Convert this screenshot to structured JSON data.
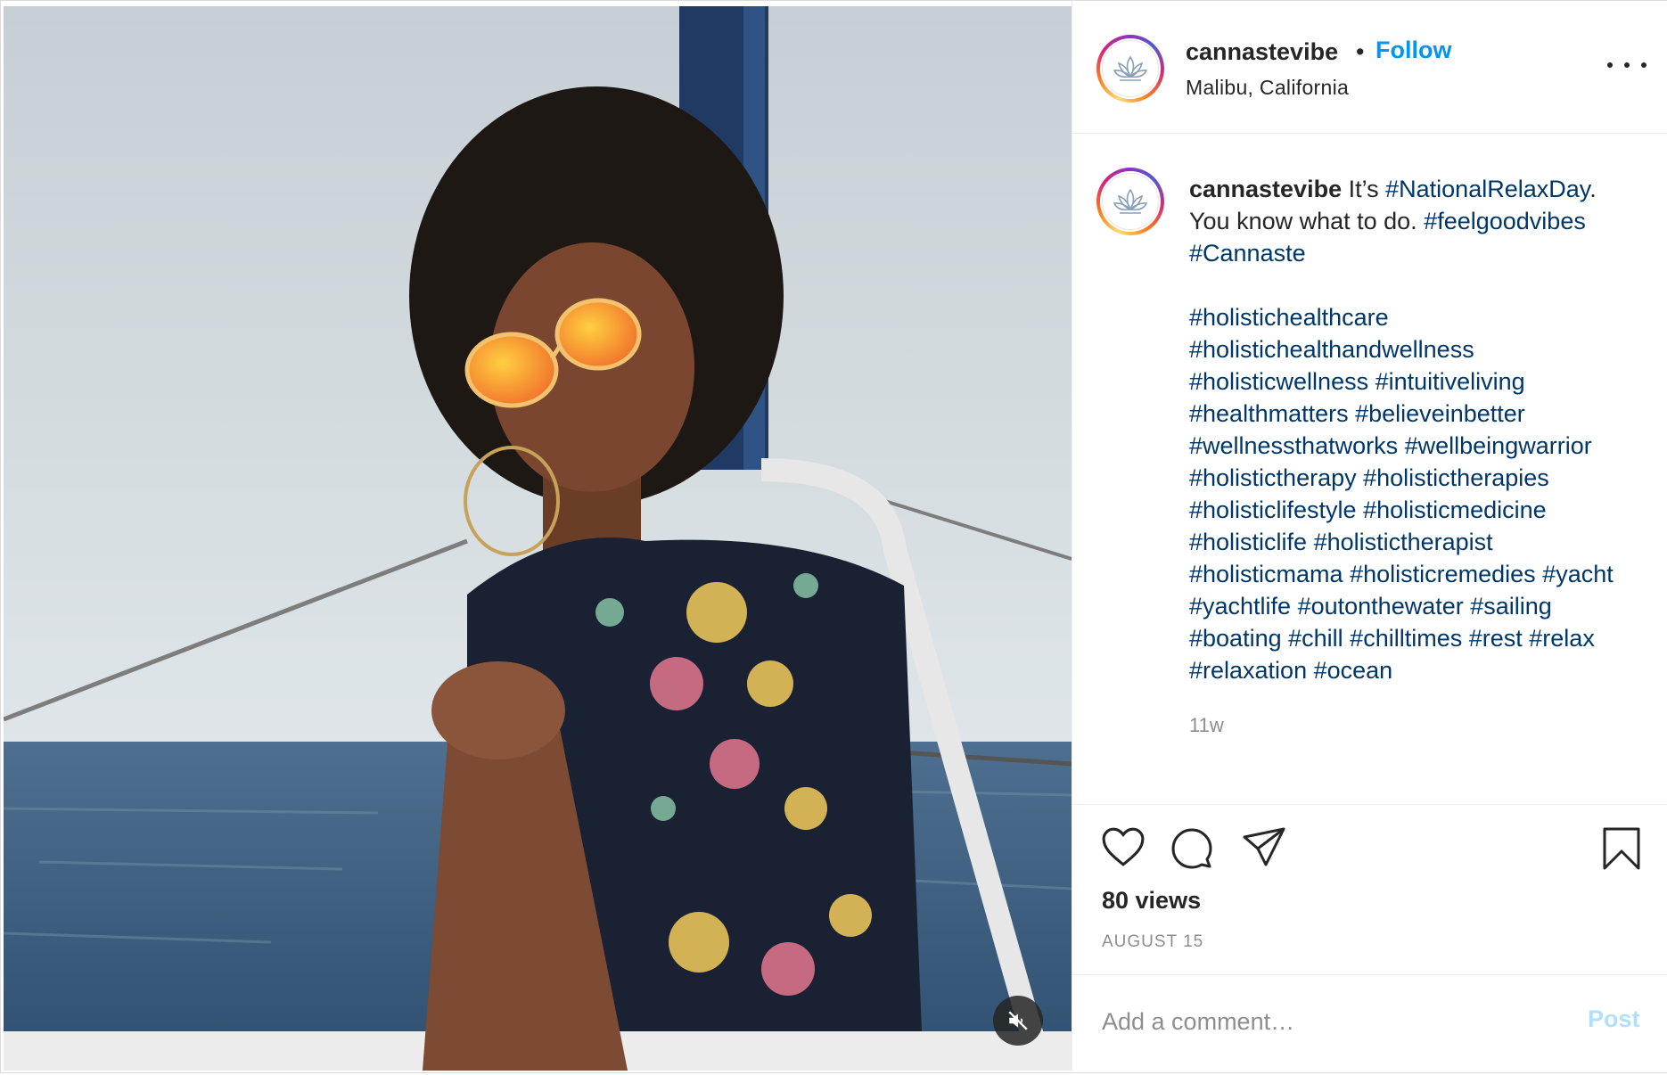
{
  "post": {
    "username": "cannastevibe",
    "separator": "•",
    "follow_label": "Follow",
    "location": "Malibu, California"
  },
  "caption": {
    "username": "cannastevibe",
    "segments": [
      {
        "text": " It’s ",
        "type": "text"
      },
      {
        "text": "#NationalRelaxDay",
        "type": "tag"
      },
      {
        "text": ". You know what to do. ",
        "type": "text"
      },
      {
        "text": "#feelgoodvibes",
        "type": "tag"
      },
      {
        "text": " ",
        "type": "text"
      },
      {
        "text": "#Cannaste",
        "type": "tag"
      },
      {
        "text": "\n\n",
        "type": "text"
      },
      {
        "text": "#holistichealthcare",
        "type": "tag"
      },
      {
        "text": " ",
        "type": "text"
      },
      {
        "text": "#holistichealthandwellness",
        "type": "tag"
      },
      {
        "text": " ",
        "type": "text"
      },
      {
        "text": "#holisticwellness",
        "type": "tag"
      },
      {
        "text": " ",
        "type": "text"
      },
      {
        "text": "#intuitiveliving",
        "type": "tag"
      },
      {
        "text": " ",
        "type": "text"
      },
      {
        "text": "#healthmatters",
        "type": "tag"
      },
      {
        "text": " ",
        "type": "text"
      },
      {
        "text": "#believeinbetter",
        "type": "tag"
      },
      {
        "text": " ",
        "type": "text"
      },
      {
        "text": "#wellnessthatworks",
        "type": "tag"
      },
      {
        "text": " ",
        "type": "text"
      },
      {
        "text": "#wellbeingwarrior",
        "type": "tag"
      },
      {
        "text": " ",
        "type": "text"
      },
      {
        "text": "#holistictherapy",
        "type": "tag"
      },
      {
        "text": " ",
        "type": "text"
      },
      {
        "text": "#holistictherapies",
        "type": "tag"
      },
      {
        "text": " ",
        "type": "text"
      },
      {
        "text": "#holisticlifestyle",
        "type": "tag"
      },
      {
        "text": " ",
        "type": "text"
      },
      {
        "text": "#holisticmedicine",
        "type": "tag"
      },
      {
        "text": " ",
        "type": "text"
      },
      {
        "text": "#holisticlife",
        "type": "tag"
      },
      {
        "text": " ",
        "type": "text"
      },
      {
        "text": "#holistictherapist",
        "type": "tag"
      },
      {
        "text": " ",
        "type": "text"
      },
      {
        "text": "#holisticmama",
        "type": "tag"
      },
      {
        "text": " ",
        "type": "text"
      },
      {
        "text": "#holisticremedies",
        "type": "tag"
      },
      {
        "text": " ",
        "type": "text"
      },
      {
        "text": "#yacht",
        "type": "tag"
      },
      {
        "text": " ",
        "type": "text"
      },
      {
        "text": "#yachtlife",
        "type": "tag"
      },
      {
        "text": " ",
        "type": "text"
      },
      {
        "text": "#outonthewater",
        "type": "tag"
      },
      {
        "text": " ",
        "type": "text"
      },
      {
        "text": "#sailing",
        "type": "tag"
      },
      {
        "text": " ",
        "type": "text"
      },
      {
        "text": "#boating",
        "type": "tag"
      },
      {
        "text": " ",
        "type": "text"
      },
      {
        "text": "#chill",
        "type": "tag"
      },
      {
        "text": " ",
        "type": "text"
      },
      {
        "text": "#chilltimes",
        "type": "tag"
      },
      {
        "text": " ",
        "type": "text"
      },
      {
        "text": "#rest",
        "type": "tag"
      },
      {
        "text": " ",
        "type": "text"
      },
      {
        "text": "#relax",
        "type": "tag"
      },
      {
        "text": " ",
        "type": "text"
      },
      {
        "text": "#relaxation",
        "type": "tag"
      },
      {
        "text": " ",
        "type": "text"
      },
      {
        "text": "#ocean",
        "type": "tag"
      }
    ],
    "time_ago": "11w"
  },
  "stats": {
    "views": "80 views",
    "date": "AUGUST 15"
  },
  "comment": {
    "placeholder": "Add a comment…",
    "post_label": "Post"
  },
  "icons": {
    "like": "heart-icon",
    "comment": "comment-icon",
    "share": "share-icon",
    "save": "bookmark-icon",
    "more": "more-options-icon",
    "mute": "muted-speaker-icon",
    "avatar": "lotus-logo"
  },
  "colors": {
    "link_blue": "#0095f6",
    "hashtag": "#00376b",
    "post_disabled": "#b2dffc",
    "muted_text": "#8e8e8e"
  }
}
